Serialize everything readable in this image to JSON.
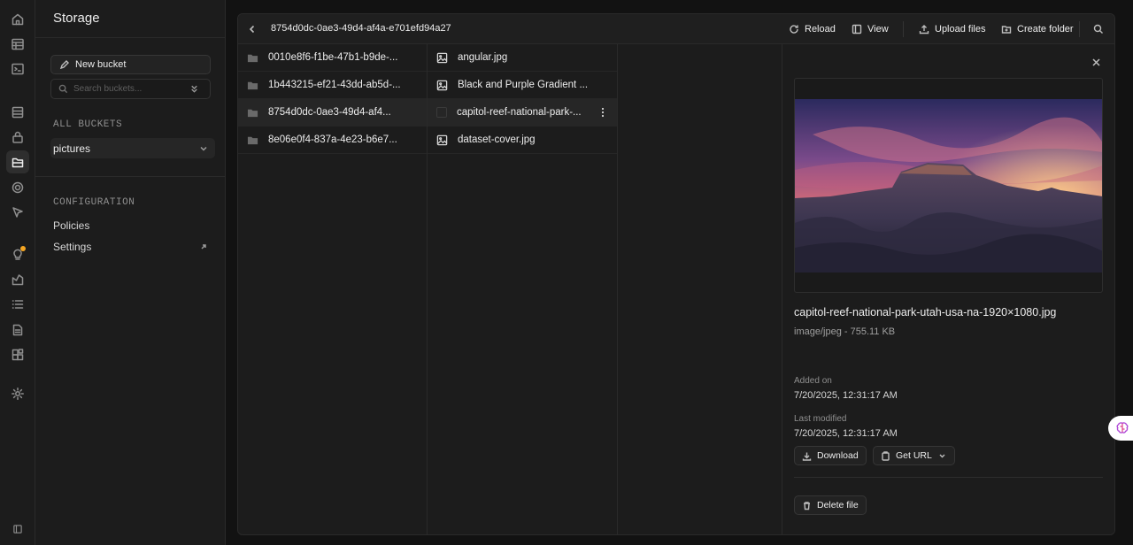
{
  "sidebar": {
    "title": "Storage",
    "new_bucket_label": "New bucket",
    "search_placeholder": "Search buckets...",
    "all_buckets_label": "ALL BUCKETS",
    "buckets": [
      {
        "name": "pictures"
      }
    ],
    "configuration_label": "CONFIGURATION",
    "links": [
      {
        "label": "Policies"
      },
      {
        "label": "Settings"
      }
    ]
  },
  "rail": {
    "icons": [
      "home-icon",
      "table-editor-icon",
      "sql-editor-icon",
      "database-icon",
      "auth-icon",
      "storage-icon",
      "realtime-icon",
      "edge-functions-icon",
      "advisors-icon",
      "reports-icon",
      "logs-icon",
      "api-docs-icon",
      "integrations-icon",
      "settings-icon",
      "collapse-sidebar-icon"
    ],
    "active": "storage-icon",
    "accent": "#f5a623"
  },
  "header": {
    "breadcrumb": "8754d0dc-0ae3-49d4-af4a-e701efd94a27",
    "reload_label": "Reload",
    "view_label": "View",
    "upload_label": "Upload files",
    "create_folder_label": "Create folder"
  },
  "folders": [
    {
      "name": "0010e8f6-f1be-47b1-b9de-..."
    },
    {
      "name": "1b443215-ef21-43dd-ab5d-..."
    },
    {
      "name": "8754d0dc-0ae3-49d4-af4..."
    },
    {
      "name": "8e06e0f4-837a-4e23-b6e7..."
    }
  ],
  "files": [
    {
      "name": "angular.jpg"
    },
    {
      "name": "Black and Purple Gradient ..."
    },
    {
      "name": "capitol-reef-national-park-..."
    },
    {
      "name": "dataset-cover.jpg"
    }
  ],
  "preview": {
    "file_name": "capitol-reef-national-park-utah-usa-na-1920×1080.jpg",
    "meta": "image/jpeg - 755.11 KB",
    "added_label": "Added on",
    "added_value": "7/20/2025, 12:31:17 AM",
    "modified_label": "Last modified",
    "modified_value": "7/20/2025, 12:31:17 AM",
    "download_label": "Download",
    "get_url_label": "Get URL",
    "delete_label": "Delete file"
  }
}
